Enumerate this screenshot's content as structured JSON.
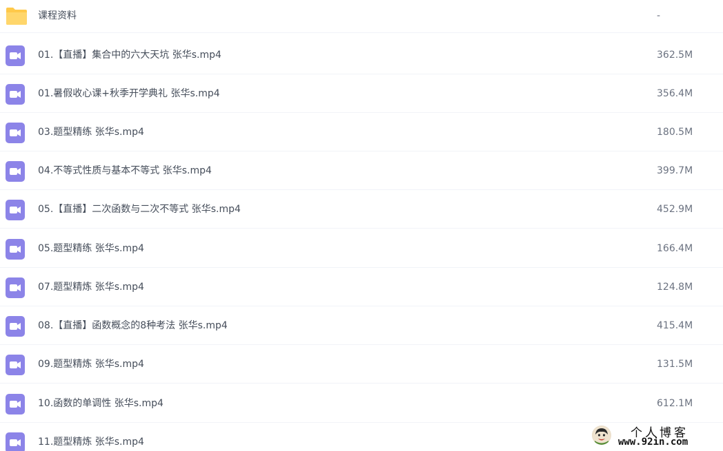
{
  "files": [
    {
      "name": "课程资料",
      "size": "-",
      "icon": "folder-icon"
    },
    {
      "name": "01.【直播】集合中的六大天坑 张华s.mp4",
      "size": "362.5M",
      "icon": "video-icon"
    },
    {
      "name": "01.暑假收心课+秋季开学典礼 张华s.mp4",
      "size": "356.4M",
      "icon": "video-icon"
    },
    {
      "name": "03.题型精练 张华s.mp4",
      "size": "180.5M",
      "icon": "video-icon"
    },
    {
      "name": "04.不等式性质与基本不等式 张华s.mp4",
      "size": "399.7M",
      "icon": "video-icon"
    },
    {
      "name": "05.【直播】二次函数与二次不等式 张华s.mp4",
      "size": "452.9M",
      "icon": "video-icon"
    },
    {
      "name": "05.题型精练 张华s.mp4",
      "size": "166.4M",
      "icon": "video-icon"
    },
    {
      "name": "07.题型精炼 张华s.mp4",
      "size": "124.8M",
      "icon": "video-icon"
    },
    {
      "name": "08.【直播】函数概念的8种考法 张华s.mp4",
      "size": "415.4M",
      "icon": "video-icon"
    },
    {
      "name": "09.题型精炼 张华s.mp4",
      "size": "131.5M",
      "icon": "video-icon"
    },
    {
      "name": "10.函数的单调性 张华s.mp4",
      "size": "612.1M",
      "icon": "video-icon"
    },
    {
      "name": "11.题型精炼 张华s.mp4",
      "size": "",
      "icon": "video-icon"
    }
  ],
  "watermark": {
    "title": "个人博客",
    "url": "www.92in.com"
  },
  "colors": {
    "folder": "#ffc94a",
    "video": "#8c84e8",
    "text": "#454d5a",
    "divider": "#f1f3f8"
  }
}
